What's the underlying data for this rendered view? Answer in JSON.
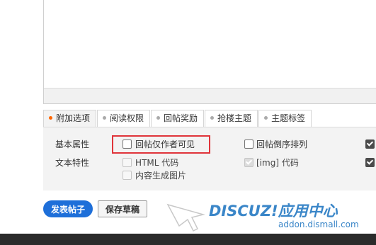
{
  "tabs": [
    {
      "label": "附加选项",
      "active": true
    },
    {
      "label": "阅读权限",
      "active": false
    },
    {
      "label": "回帖奖励",
      "active": false
    },
    {
      "label": "抢楼主题",
      "active": false
    },
    {
      "label": "主题标签",
      "active": false
    }
  ],
  "options": {
    "basic_label": "基本属性",
    "text_label": "文本特性",
    "reply_only_author": {
      "label": "回帖仅作者可见",
      "checked": false
    },
    "reply_reverse_order": {
      "label": "回帖倒序排列",
      "checked": false
    },
    "html_code": {
      "label": "HTML 代码",
      "checked": false,
      "disabled": true
    },
    "img_code": {
      "label": "[img] 代码",
      "checked": true,
      "disabled": true
    },
    "content_image": {
      "label": "内容生成图片",
      "checked": false,
      "disabled": true
    }
  },
  "buttons": {
    "publish": "发表帖子",
    "save_draft": "保存草稿"
  },
  "watermark": {
    "brand": "DISCUZ!应用中心",
    "url": "addon.dismall.com"
  },
  "colors": {
    "primary_button": "#1e6fd9",
    "highlight_border": "#e0343a",
    "active_dot": "#ff6600",
    "watermark": "#3a86c8"
  }
}
